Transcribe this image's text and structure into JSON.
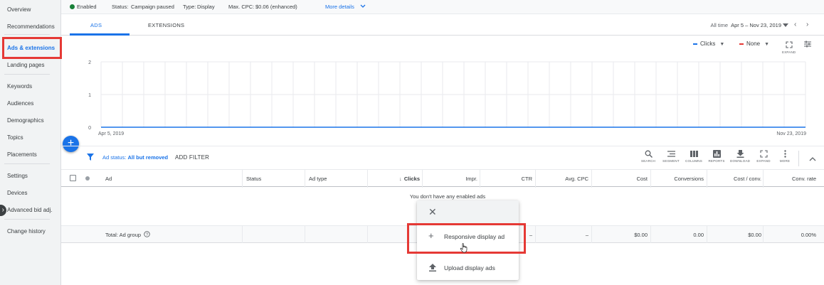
{
  "sidebar": {
    "items": [
      {
        "label": "Overview"
      },
      {
        "label": "Recommendations"
      },
      {
        "label": "Ads & extensions",
        "active": true
      },
      {
        "label": "Landing pages"
      },
      {
        "label": "Keywords"
      },
      {
        "label": "Audiences"
      },
      {
        "label": "Demographics"
      },
      {
        "label": "Topics"
      },
      {
        "label": "Placements"
      },
      {
        "label": "Settings"
      },
      {
        "label": "Devices"
      },
      {
        "label": "Advanced bid adj."
      },
      {
        "label": "Change history"
      }
    ],
    "collapse_glyph": "›"
  },
  "status_bar": {
    "status": "Enabled",
    "status_label": "Status:",
    "status_value": "Campaign paused",
    "type_label": "Type:",
    "type_value": "Display",
    "cpc_label": "Max. CPC:",
    "cpc_value": "$0.06 (enhanced)",
    "more_details": "More details"
  },
  "tabs": [
    {
      "label": "ADS",
      "active": true
    },
    {
      "label": "EXTENSIONS",
      "active": false
    }
  ],
  "date_range": {
    "label": "All time",
    "value": "Apr 5 – Nov 23, 2019"
  },
  "chart_controls": {
    "metric1": "Clicks",
    "metric2": "None",
    "expand_label": "EXPAND"
  },
  "chart_data": {
    "type": "line",
    "x_start_label": "Apr 5, 2019",
    "x_end_label": "Nov 23, 2019",
    "y_ticks": [
      "2",
      "1",
      "0"
    ],
    "ylim": [
      0,
      2
    ],
    "series": [
      {
        "values": [
          0,
          0
        ]
      }
    ],
    "grid": true,
    "accent": "#1a73e8"
  },
  "filter": {
    "prefix": "Ad status:",
    "value": "All but removed",
    "add_filter": "ADD FILTER"
  },
  "toolbar": [
    {
      "label": "SEARCH",
      "icon": "search-icon"
    },
    {
      "label": "SEGMENT",
      "icon": "segment-icon"
    },
    {
      "label": "COLUMNS",
      "icon": "columns-icon"
    },
    {
      "label": "REPORTS",
      "icon": "reports-icon"
    },
    {
      "label": "DOWNLOAD",
      "icon": "download-icon"
    },
    {
      "label": "EXPAND",
      "icon": "expand-icon"
    },
    {
      "label": "MORE",
      "icon": "more-icon"
    }
  ],
  "table": {
    "columns": [
      "Ad",
      "Status",
      "Ad type",
      "Clicks",
      "Impr.",
      "CTR",
      "Avg. CPC",
      "Cost",
      "Conversions",
      "Cost / conv.",
      "Conv. rate"
    ],
    "empty_message": "You don't have any enabled ads",
    "total": {
      "label": "Total: Ad group",
      "ctr": "–",
      "avg_cpc": "–",
      "cost": "$0.00",
      "conversions": "0.00",
      "cost_conv": "$0.00",
      "conv_rate": "0.00%"
    }
  },
  "popup": {
    "items": [
      {
        "label": "Responsive display ad",
        "icon": "plus-icon"
      },
      {
        "label": "Upload display ads",
        "icon": "upload-icon"
      }
    ]
  }
}
